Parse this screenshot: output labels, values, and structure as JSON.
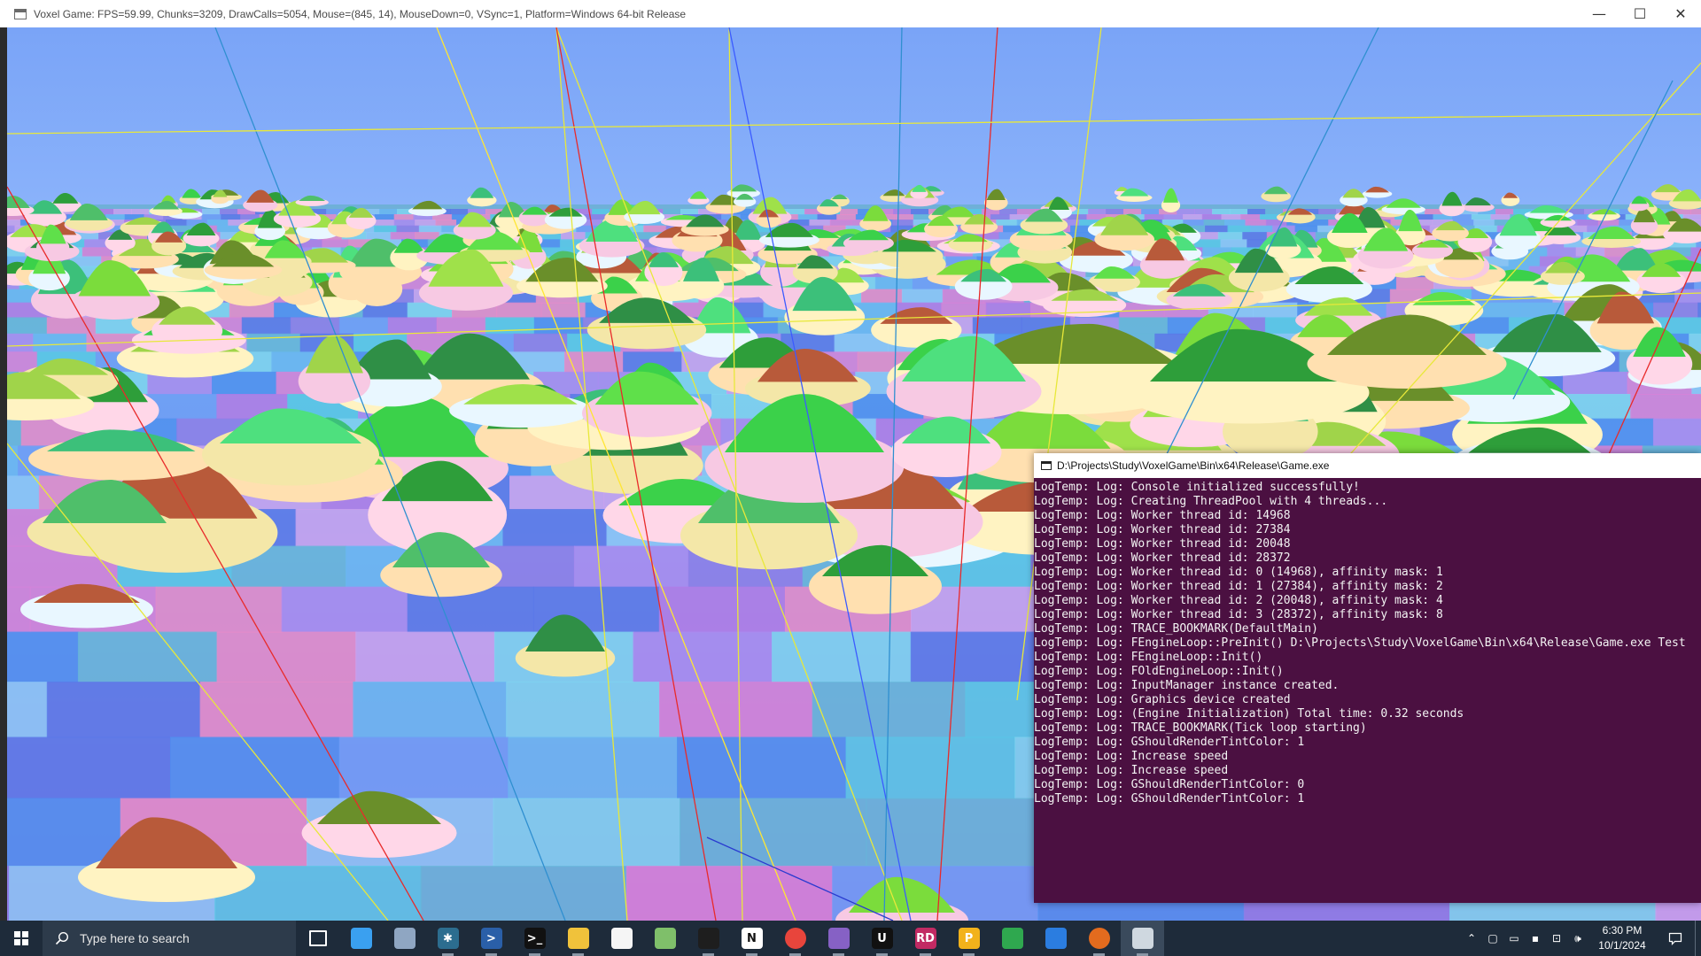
{
  "game_window": {
    "title": "Voxel Game: FPS=59.99, Chunks=3209, DrawCalls=5054, Mouse=(845, 14), MouseDown=0, VSync=1, Platform=Windows 64-bit Release",
    "minimize": "—",
    "maximize": "☐",
    "close": "✕"
  },
  "console": {
    "title": "D:\\Projects\\Study\\VoxelGame\\Bin\\x64\\Release\\Game.exe",
    "lines": [
      "LogTemp: Log: Console initialized successfully!",
      "LogTemp: Log: Creating ThreadPool with 4 threads...",
      "LogTemp: Log: Worker thread id: 14968",
      "LogTemp: Log: Worker thread id: 27384",
      "LogTemp: Log: Worker thread id: 20048",
      "LogTemp: Log: Worker thread id: 28372",
      "LogTemp: Log: Worker thread id: 0 (14968), affinity mask: 1",
      "LogTemp: Log: Worker thread id: 1 (27384), affinity mask: 2",
      "LogTemp: Log: Worker thread id: 2 (20048), affinity mask: 4",
      "LogTemp: Log: Worker thread id: 3 (28372), affinity mask: 8",
      "LogTemp: Log: TRACE_BOOKMARK(DefaultMain)",
      "LogTemp: Log: FEngineLoop::PreInit() D:\\Projects\\Study\\VoxelGame\\Bin\\x64\\Release\\Game.exe Test",
      "LogTemp: Log: FEngineLoop::Init()",
      "LogTemp: Log: FOldEngineLoop::Init()",
      "LogTemp: Log: InputManager instance created.",
      "LogTemp: Log: Graphics device created",
      "LogTemp: Log: (Engine Initialization) Total time: 0.32 seconds",
      "LogTemp: Log: TRACE_BOOKMARK(Tick loop starting)",
      "LogTemp: Log: GShouldRenderTintColor: 1",
      "LogTemp: Log: Increase speed",
      "LogTemp: Log: Increase speed",
      "LogTemp: Log: GShouldRenderTintColor: 0",
      "LogTemp: Log: GShouldRenderTintColor: 1"
    ]
  },
  "taskbar": {
    "search_placeholder": "Type here to search",
    "apps": [
      {
        "icon": "task-view-icon",
        "glyph": "",
        "color": "#1e2b3a"
      },
      {
        "icon": "copilot-icon",
        "glyph": "",
        "color": "#3aa0f0"
      },
      {
        "icon": "fluent-app-icon",
        "glyph": "",
        "color": "#8fa6c2"
      },
      {
        "icon": "spark-app-icon",
        "glyph": "✱",
        "color": "#2c6d8f"
      },
      {
        "icon": "powershell-icon",
        "glyph": ">",
        "color": "#2a5fa8"
      },
      {
        "icon": "terminal-icon",
        "glyph": ">_",
        "color": "#111111"
      },
      {
        "icon": "file-explorer-icon",
        "glyph": "",
        "color": "#f0c23b"
      },
      {
        "icon": "notepad-icon",
        "glyph": "",
        "color": "#f5f5f5"
      },
      {
        "icon": "spreadsheet-app-icon",
        "glyph": "",
        "color": "#7fbf6a"
      },
      {
        "icon": "figma-icon",
        "glyph": "",
        "color": "#1e1e1e"
      },
      {
        "icon": "notion-icon",
        "glyph": "N",
        "color": "#ffffff"
      },
      {
        "icon": "chrome-icon",
        "glyph": "",
        "color": "#e8453c"
      },
      {
        "icon": "visual-studio-icon",
        "glyph": "",
        "color": "#8661c5"
      },
      {
        "icon": "unreal-engine-icon",
        "glyph": "U",
        "color": "#111111"
      },
      {
        "icon": "renderdoc-icon",
        "glyph": "RD",
        "color": "#c22a63"
      },
      {
        "icon": "profiler-icon",
        "glyph": "P",
        "color": "#f2b21b"
      },
      {
        "icon": "github-desktop-icon",
        "glyph": "",
        "color": "#2fa84f"
      },
      {
        "icon": "maps-icon",
        "glyph": "",
        "color": "#2b7de0"
      },
      {
        "icon": "firefox-icon",
        "glyph": "",
        "color": "#e36b1e"
      },
      {
        "icon": "game-window-icon",
        "glyph": "",
        "color": "#cfd8e0"
      }
    ],
    "clock_time": "6:30 PM",
    "clock_date": "10/1/2024"
  }
}
